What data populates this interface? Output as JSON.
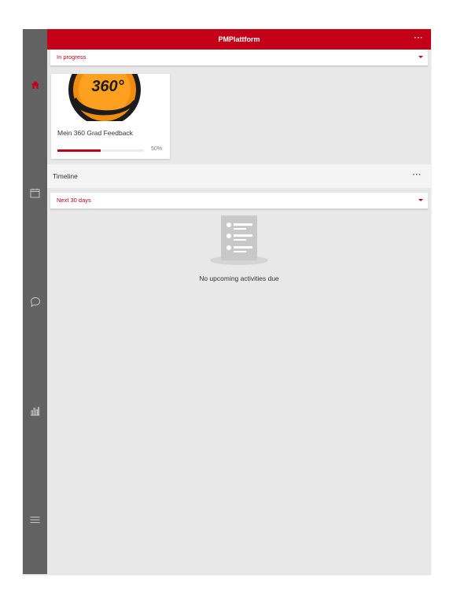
{
  "app": {
    "title": "PMPlattform",
    "more_label": "···"
  },
  "sidebar": {
    "items": [
      {
        "name": "home",
        "icon": "home-icon",
        "active": true
      },
      {
        "name": "calendar",
        "icon": "calendar-icon"
      },
      {
        "name": "chat",
        "icon": "chat-bubble-icon"
      },
      {
        "name": "reports",
        "icon": "bar-chart-icon"
      },
      {
        "name": "menu",
        "icon": "hamburger-menu-icon"
      }
    ]
  },
  "filters": {
    "status": "In progress",
    "period": "Next 30 days"
  },
  "cards": [
    {
      "title": "Mein 360 Grad Feedback",
      "progress": 50,
      "progress_label": "50%",
      "image_text": "360°"
    }
  ],
  "timeline": {
    "title": "Timeline",
    "more_label": "···",
    "empty_message": "No upcoming activities due"
  },
  "colors": {
    "accent": "#c40018",
    "sidebar": "#626262",
    "background": "#e8e8e8"
  }
}
